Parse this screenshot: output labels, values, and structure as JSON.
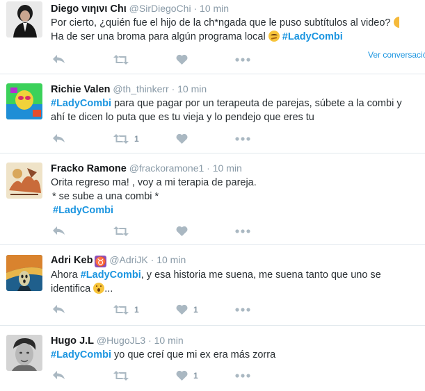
{
  "tweets": [
    {
      "fullname": "Diego vιηινι Chι",
      "handle": "@SirDiegoChi",
      "sep": "·",
      "time": "10 min",
      "lines": [
        "Por cierto, ¿quién fue el hijo de la ch*ngada que le puso subtítulos al video?",
        "Ha de ser una broma para algún programa local"
      ],
      "hashtag": "#LadyCombi",
      "view_conversation": "Ver conversación",
      "retweets": "",
      "likes": ""
    },
    {
      "fullname": "Richie Valen",
      "handle": "@th_thinkerr",
      "sep": "·",
      "time": "10 min",
      "hashtag": "#LadyCombi",
      "lines": [
        " para que pagar por un terapeuta de parejas, súbete a la combi y",
        "ahí te dicen lo puta que es tu vieja y lo pendejo que eres tu"
      ],
      "retweets": "1",
      "likes": ""
    },
    {
      "fullname": "Fracko Ramone",
      "handle": "@frackoramone1",
      "sep": "·",
      "time": "10 min",
      "lines": [
        "Orita regreso ma! , voy a mi terapia de pareja.",
        "* se sube a una combi *"
      ],
      "hashtag": "#LadyCombi",
      "retweets": "",
      "likes": ""
    },
    {
      "fullname": "Adri Keb",
      "zodiac": "♉",
      "handle": "@AdriJK",
      "sep": "·",
      "time": "10 min",
      "prefix": "Ahora ",
      "hashtag": "#LadyCombi",
      "lines": [
        ", y esa historia me suena, me suena tanto que uno se",
        "identifica",
        "..."
      ],
      "retweets": "1",
      "likes": "1"
    },
    {
      "fullname": "Hugo J.L",
      "handle": "@HugoJL3",
      "sep": "·",
      "time": "10 min",
      "hashtag": "#LadyCombi",
      "lines": [
        " yo que creí que mi ex era más zorra"
      ],
      "retweets": "",
      "likes": "1"
    }
  ],
  "icons": {
    "reply": "reply-icon",
    "retweet": "retweet-icon",
    "like": "heart-icon",
    "more": "more-icon"
  },
  "colors": {
    "hashtag": "#1b95e0",
    "secondary": "#8899a6",
    "action_icon": "#aab8c2",
    "divider": "#e1e8ed"
  }
}
